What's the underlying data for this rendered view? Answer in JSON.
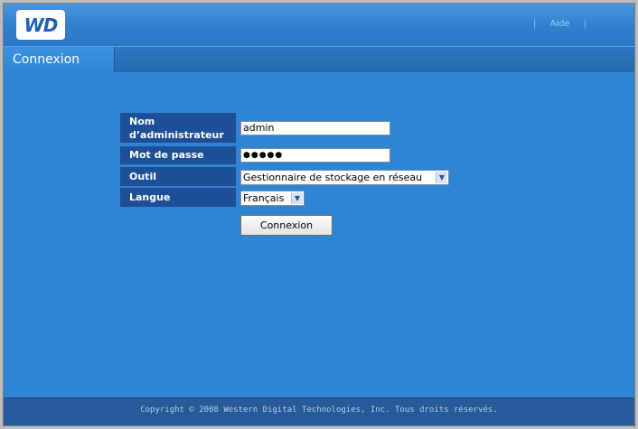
{
  "header": {
    "logo_text": "WD",
    "help_label": "Aide"
  },
  "tab": {
    "label": "Connexion"
  },
  "form": {
    "admin_label_line1": "Nom",
    "admin_label_line2": "d’administrateur",
    "admin_value": "admin",
    "password_label": "Mot de passe",
    "password_value": "●●●●●",
    "tool_label": "Outil",
    "tool_selected": "Gestionnaire de stockage en réseau",
    "language_label": "Langue",
    "language_selected": "Français",
    "submit_label": "Connexion"
  },
  "footer": {
    "copyright": "Copyright © 2008 Western Digital Technologies, Inc. Tous droits réservés."
  },
  "colors": {
    "background": "#2f84d4",
    "label_bg": "#1c4f95",
    "footer_bg": "#265a9a"
  },
  "icons": {
    "dropdown": "chevron-down-icon"
  }
}
